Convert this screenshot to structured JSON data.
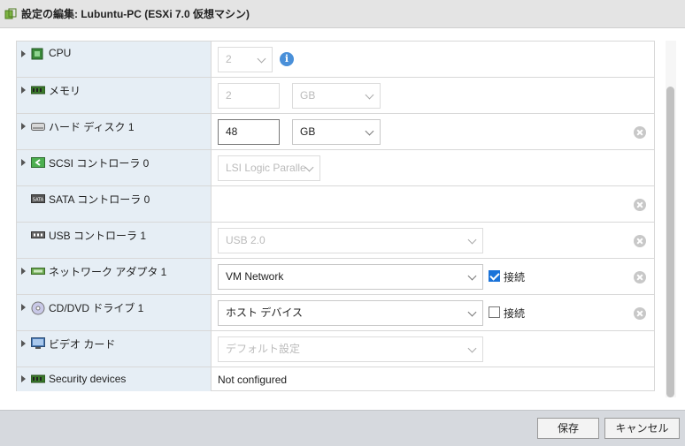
{
  "window": {
    "title": "設定の編集: Lubuntu-PC (ESXi 7.0 仮想マシン)"
  },
  "devices": {
    "cpu": {
      "label": "CPU",
      "value": "2",
      "icon": "cpu-chip-icon"
    },
    "memory": {
      "label": "メモリ",
      "value": "2",
      "unit": "GB",
      "icon": "memory-icon"
    },
    "disk": {
      "label": "ハード ディスク 1",
      "value": "48",
      "unit": "GB",
      "icon": "hard-disk-icon"
    },
    "scsi": {
      "label": "SCSI コントローラ 0",
      "value": "LSI Logic Paralle",
      "icon": "scsi-controller-icon"
    },
    "sata": {
      "label": "SATA コントローラ 0",
      "icon": "sata-controller-icon"
    },
    "usb": {
      "label": "USB コントローラ 1",
      "value": "USB 2.0",
      "icon": "usb-icon"
    },
    "network": {
      "label": "ネットワーク アダプタ 1",
      "value": "VM Network",
      "connect_label": "接続",
      "connected": true,
      "icon": "network-adapter-icon"
    },
    "cdrom": {
      "label": "CD/DVD ドライブ 1",
      "value": "ホスト デバイス",
      "connect_label": "接続",
      "connected": false,
      "icon": "cd-dvd-icon"
    },
    "video": {
      "label": "ビデオ カード",
      "value": "デフォルト設定",
      "icon": "video-card-icon"
    },
    "security": {
      "label": "Security devices",
      "value": "Not configured",
      "icon": "security-device-icon"
    }
  },
  "footer": {
    "save_label": "保存",
    "cancel_label": "キャンセル"
  },
  "colors": {
    "label_bg": "#e6eef5",
    "accent": "#1a73d9",
    "footer_bg": "#d6d9de"
  }
}
